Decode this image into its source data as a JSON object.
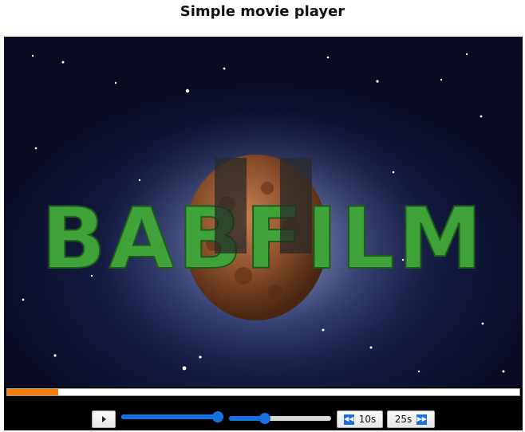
{
  "page": {
    "title": "Simple movie player"
  },
  "video": {
    "logo_text": "BABFILM",
    "state": "paused",
    "progress_fraction": 0.1
  },
  "controls": {
    "play_icon": "play-icon",
    "seek_fraction": 0.96,
    "volume_fraction": 0.35,
    "rewind": {
      "label": "10s",
      "icon": "rewind-icon"
    },
    "forward": {
      "label": "25s",
      "icon": "fast-forward-icon"
    }
  },
  "colors": {
    "progress_fill": "#f47f0f",
    "slider_accent": "#1772e0",
    "logo_green": "#3fa33a"
  }
}
